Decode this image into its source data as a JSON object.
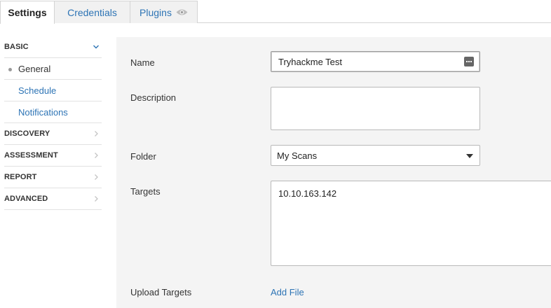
{
  "tabs": [
    {
      "label": "Settings"
    },
    {
      "label": "Credentials"
    },
    {
      "label": "Plugins"
    }
  ],
  "sidebar": {
    "basic": {
      "label": "BASIC"
    },
    "basic_items": [
      {
        "label": "General"
      },
      {
        "label": "Schedule"
      },
      {
        "label": "Notifications"
      }
    ],
    "sections": [
      {
        "label": "DISCOVERY"
      },
      {
        "label": "ASSESSMENT"
      },
      {
        "label": "REPORT"
      },
      {
        "label": "ADVANCED"
      }
    ]
  },
  "form": {
    "name_label": "Name",
    "name_value": "Tryhackme Test",
    "description_label": "Description",
    "description_value": "",
    "folder_label": "Folder",
    "folder_value": "My Scans",
    "targets_label": "Targets",
    "targets_value": "10.10.163.142",
    "upload_label": "Upload Targets",
    "upload_link": "Add File"
  },
  "colors": {
    "link": "#2d74b5",
    "panel_bg": "#f4f4f4",
    "tab_inactive_bg": "#f1f1f1"
  },
  "icons": {
    "plugins_tab": "eye-icon",
    "basic_section": "chevron-down-icon",
    "collapsed_section": "chevron-right-icon",
    "name_field": "password-manager-icon",
    "folder_select": "caret-down-icon"
  }
}
